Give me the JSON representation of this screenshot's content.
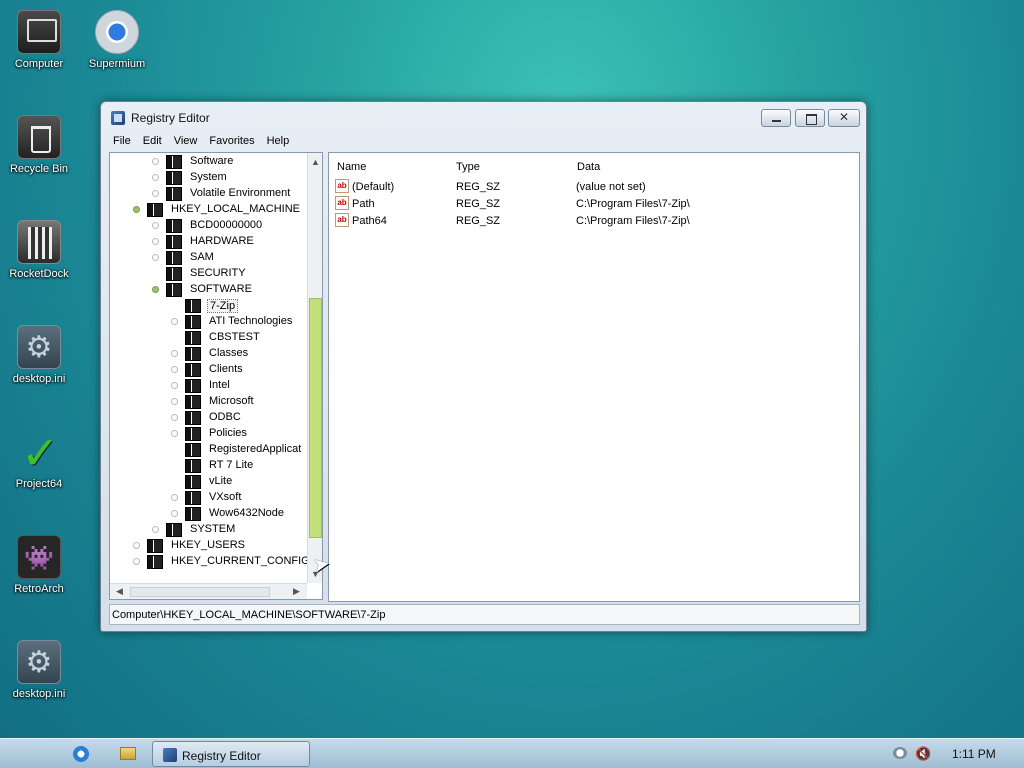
{
  "desktop": {
    "icons": [
      {
        "label": "Computer",
        "icon": "computer-icon"
      },
      {
        "label": "Supermium",
        "icon": "browser-icon"
      },
      {
        "label": "Recycle Bin",
        "icon": "recycle-bin-icon"
      },
      {
        "label": "RocketDock",
        "icon": "rocketdock-icon"
      },
      {
        "label": "desktop.ini",
        "icon": "settings-file-icon"
      },
      {
        "label": "Project64",
        "icon": "project64-icon"
      },
      {
        "label": "RetroArch",
        "icon": "retroarch-icon"
      },
      {
        "label": "desktop.ini",
        "icon": "settings-file-icon"
      }
    ]
  },
  "window": {
    "title": "Registry Editor",
    "menu": [
      "File",
      "Edit",
      "View",
      "Favorites",
      "Help"
    ],
    "tree": [
      {
        "label": "Software",
        "level": 2
      },
      {
        "label": "System",
        "level": 2
      },
      {
        "label": "Volatile Environment",
        "level": 2
      },
      {
        "label": "HKEY_LOCAL_MACHINE",
        "level": 1,
        "expanded": true
      },
      {
        "label": "BCD00000000",
        "level": 2
      },
      {
        "label": "HARDWARE",
        "level": 2
      },
      {
        "label": "SAM",
        "level": 2
      },
      {
        "label": "SECURITY",
        "level": 2
      },
      {
        "label": "SOFTWARE",
        "level": 2,
        "expanded": true
      },
      {
        "label": "7-Zip",
        "level": 3,
        "selected": true
      },
      {
        "label": "ATI Technologies",
        "level": 3
      },
      {
        "label": "CBSTEST",
        "level": 3
      },
      {
        "label": "Classes",
        "level": 3
      },
      {
        "label": "Clients",
        "level": 3
      },
      {
        "label": "Intel",
        "level": 3
      },
      {
        "label": "Microsoft",
        "level": 3
      },
      {
        "label": "ODBC",
        "level": 3
      },
      {
        "label": "Policies",
        "level": 3
      },
      {
        "label": "RegisteredApplicat",
        "level": 3
      },
      {
        "label": "RT 7 Lite",
        "level": 3
      },
      {
        "label": "vLite",
        "level": 3
      },
      {
        "label": "VXsoft",
        "level": 3
      },
      {
        "label": "Wow6432Node",
        "level": 3
      },
      {
        "label": "SYSTEM",
        "level": 2
      },
      {
        "label": "HKEY_USERS",
        "level": 1
      },
      {
        "label": "HKEY_CURRENT_CONFIG",
        "level": 1
      }
    ],
    "columns": {
      "name": "Name",
      "type": "Type",
      "data": "Data"
    },
    "values": [
      {
        "name": "(Default)",
        "type": "REG_SZ",
        "data": "(value not set)"
      },
      {
        "name": "Path",
        "type": "REG_SZ",
        "data": "C:\\Program Files\\7-Zip\\"
      },
      {
        "name": "Path64",
        "type": "REG_SZ",
        "data": "C:\\Program Files\\7-Zip\\"
      }
    ],
    "status": "Computer\\HKEY_LOCAL_MACHINE\\SOFTWARE\\7-Zip"
  },
  "taskbar": {
    "task_label": "Registry Editor",
    "clock": "1:11 PM"
  }
}
